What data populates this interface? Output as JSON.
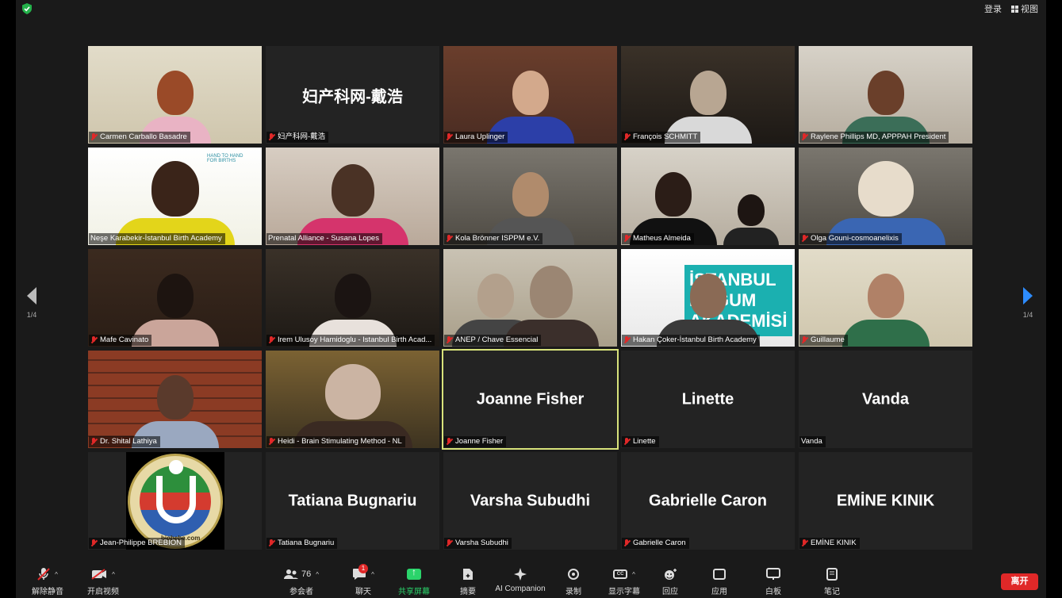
{
  "header": {
    "login_label": "登录",
    "view_label": "视图"
  },
  "nav": {
    "left_page": "1/4",
    "right_page": "1/4"
  },
  "participants": [
    {
      "name": "Carmen Carballo Basadre",
      "muted": true,
      "video": true
    },
    {
      "name": "妇产科网-戴浩",
      "display_name": "妇产科网-戴浩",
      "muted": true,
      "video": false
    },
    {
      "name": "Laura Uplinger",
      "muted": true,
      "video": true
    },
    {
      "name": "François SCHMITT",
      "muted": true,
      "video": true
    },
    {
      "name": "Raylene Phillips MD, APPPAH President",
      "muted": true,
      "video": true
    },
    {
      "name": "Neşe Karabekir-İstanbul Birth Academy",
      "muted": false,
      "video": true
    },
    {
      "name": "Prenatal Alliance - Susana Lopes",
      "muted": false,
      "video": true
    },
    {
      "name": "Kola Brönner ISPPM e.V.",
      "muted": true,
      "video": true
    },
    {
      "name": "Matheus Almeida",
      "muted": true,
      "video": true
    },
    {
      "name": "Olga Gouni-cosmoanelixis",
      "muted": true,
      "video": true
    },
    {
      "name": "Mafe Cavinato",
      "muted": true,
      "video": true
    },
    {
      "name": "Irem Ulusoy Hamidoglu - Istanbul Birth Acad...",
      "muted": true,
      "video": true
    },
    {
      "name": "ANEP / Chave Essencial",
      "muted": true,
      "video": true
    },
    {
      "name": "Hakan Çoker-İstanbul Birth Academy",
      "muted": true,
      "video": true
    },
    {
      "name": "Guillaume",
      "muted": true,
      "video": true
    },
    {
      "name": "Dr. Shital Lathiya",
      "muted": true,
      "video": true
    },
    {
      "name": "Heidi - Brain Stimulating Method - NL",
      "muted": true,
      "video": true
    },
    {
      "name": "Joanne Fisher",
      "display_name": "Joanne Fisher",
      "muted": true,
      "video": false,
      "speaking": true
    },
    {
      "name": "Linette",
      "display_name": "Linette",
      "muted": true,
      "video": false
    },
    {
      "name": "Vanda",
      "display_name": "Vanda",
      "muted": false,
      "video": false
    },
    {
      "name": "Jean-Philippe BREBION",
      "muted": true,
      "video": true
    },
    {
      "name": "Tatiana Bugnariu",
      "display_name": "Tatiana Bugnariu",
      "muted": true,
      "video": false
    },
    {
      "name": "Varsha Subudhi",
      "display_name": "Varsha Subudhi",
      "muted": true,
      "video": false
    },
    {
      "name": "Gabrielle Caron",
      "display_name": "Gabrielle Caron",
      "muted": true,
      "video": false
    },
    {
      "name": "EMİNE KINIK",
      "display_name": "EMİNE KINIK",
      "muted": true,
      "video": false
    }
  ],
  "tiles_text": {
    "hand_to_hand": "HAND TO HAND\nFOR BIRTHS",
    "istanbul_banner": "İSTANBUL DOĞUM AKADEMİSİ",
    "biobebe": "biobebe.com"
  },
  "toolbar": {
    "unmute": "解除静音",
    "start_video": "开启视频",
    "participants": "参会者",
    "participants_count": "76",
    "chat": "聊天",
    "chat_badge": "1",
    "share_screen": "共享屏幕",
    "summary": "摘要",
    "ai_companion": "AI Companion",
    "record": "录制",
    "captions": "显示字幕",
    "cc_icon_text": "CC",
    "reactions": "回应",
    "apps": "应用",
    "whiteboard": "白板",
    "notes": "笔记",
    "leave": "离开"
  },
  "colors": {
    "speaking_border": "#d8e27b",
    "leave_red": "#e02828",
    "share_green": "#2bd46b",
    "nav_blue": "#2d8cff"
  }
}
